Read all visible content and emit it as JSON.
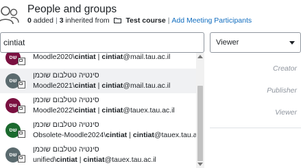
{
  "header": {
    "title": "People and groups",
    "added_count": "0",
    "added_label": "added",
    "inherited_count": "3",
    "inherited_label": "inherited from",
    "course_name": "Test course",
    "add_link": "Add Meeting Participants"
  },
  "search": {
    "value": "cintiat"
  },
  "role_select": {
    "selected": "Viewer"
  },
  "role_list": [
    "Creator",
    "Publisher",
    "Viewer"
  ],
  "results": [
    {
      "avatar_text": "שס",
      "avatar_color": "#7a1040",
      "name": "",
      "prefix": "Moodle2020\\",
      "user": "cintiat",
      "sep": "|",
      "email_user": "cintiat",
      "email_domain": "@mail.tau.ac.il"
    },
    {
      "avatar_text": "שס",
      "avatar_color": "#5a6a6e",
      "name": "סינטיה טטלבום שוכמן",
      "prefix": "Moodle2021\\",
      "user": "cintiat",
      "sep": "|",
      "email_user": "cintiat",
      "email_domain": "@mail.tau.ac.il"
    },
    {
      "avatar_text": "שס",
      "avatar_color": "#7a1040",
      "name": "סינטיה טטלבום שוכמן",
      "prefix": "Moodle2022\\",
      "user": "cintiat",
      "sep": "|",
      "email_user": "cintiat",
      "email_domain": "@tauex.tau.ac.il"
    },
    {
      "avatar_text": "שס",
      "avatar_color": "#1b6a2e",
      "name": "סינטיה טטלבום שוכמן",
      "prefix": "Obsolete-Moodle2024\\",
      "user": "cintiat",
      "sep": "|",
      "email_user": "cintiat",
      "email_domain": "@tauex.tau.ac.il"
    },
    {
      "avatar_text": "שס",
      "avatar_color": "#5a6a6e",
      "name": "סינטיה טטלבום שוכמן",
      "prefix": "unified\\",
      "user": "cintiat",
      "sep": "|",
      "email_user": "cintiat",
      "email_domain": "@tauex.tau.ac.il"
    }
  ],
  "icons": {
    "header": "people-icon",
    "course": "folder-icon",
    "badge": "calendar-icon",
    "select": "chevron-down-icon"
  }
}
